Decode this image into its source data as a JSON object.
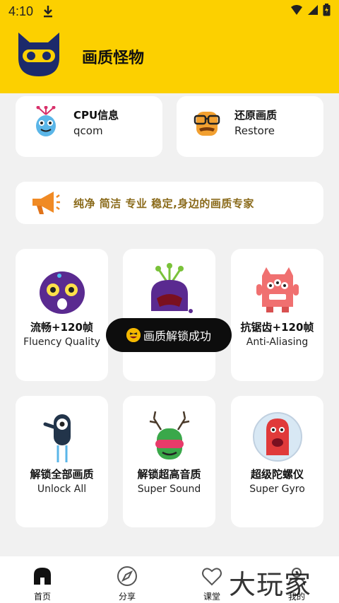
{
  "status_bar": {
    "time": "4:10"
  },
  "app_bar": {
    "title": "画质怪物"
  },
  "top_cards": [
    {
      "title": "CPU信息",
      "subtitle": "qcom"
    },
    {
      "title": "还原画质",
      "subtitle": "Restore"
    }
  ],
  "banner": {
    "text": "纯净 简洁 专业 稳定,身边的画质专家"
  },
  "tiles": [
    {
      "cn": "流畅+120帧",
      "en": "Fluency Quality"
    },
    {
      "cn": "",
      "en": ""
    },
    {
      "cn": "抗锯齿+120帧",
      "en": "Anti-Aliasing"
    },
    {
      "cn": "解锁全部画质",
      "en": "Unlock All"
    },
    {
      "cn": "解锁超高音质",
      "en": "Super Sound"
    },
    {
      "cn": "超级陀螺仪",
      "en": "Super Gyro"
    }
  ],
  "toast": {
    "text": "画质解锁成功"
  },
  "bottom_nav": [
    {
      "label": "首页",
      "icon": "home-icon"
    },
    {
      "label": "分享",
      "icon": "compass-icon"
    },
    {
      "label": "课堂",
      "icon": "heart-icon"
    },
    {
      "label": "我的",
      "icon": "user-icon"
    }
  ],
  "watermark": "大玩家",
  "colors": {
    "accent": "#fcd000",
    "banner_text": "#8a6a1a",
    "toast_bg": "#0d0d0d"
  }
}
